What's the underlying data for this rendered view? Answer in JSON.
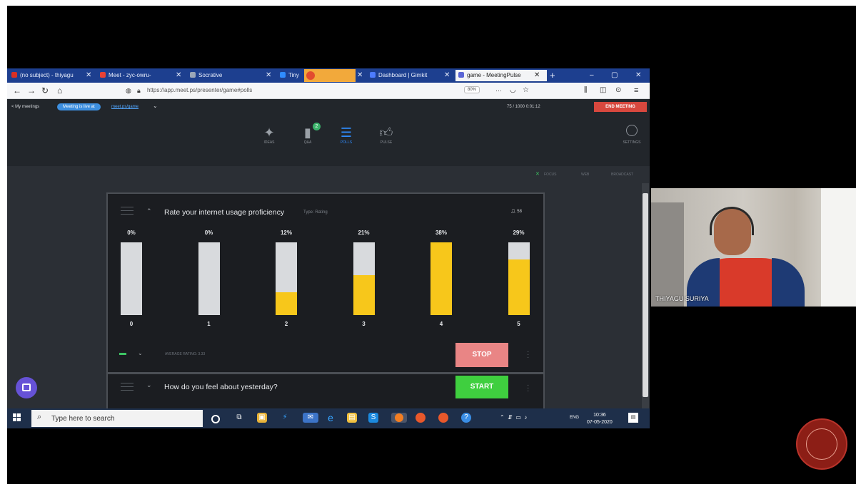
{
  "browser": {
    "tabs": [
      {
        "label": "(no subject) - thiyagu",
        "icon_color": "#d93025"
      },
      {
        "label": "Meet - zyc-owru-",
        "icon_color": "#e94235"
      },
      {
        "label": "Socrative",
        "icon_color": "#9aa6b8"
      },
      {
        "label": "Tiny",
        "icon_color": "#2f8cff"
      },
      {
        "label": "Dashboard | Gimkit",
        "icon_color": "#4d7cff"
      },
      {
        "label": "game - MeetingPulse",
        "icon_color": "#5b66d6"
      }
    ],
    "new_tab": "+",
    "url": "https://app.meet.ps/presenter/game#polls",
    "zoom": "80%"
  },
  "app": {
    "back_label": "< My meetings",
    "live_pill": "Meeting is live at",
    "live_link": "meet.ps/game",
    "stats": "75 / 1000   0:01:12",
    "end_meeting": "END MEETING",
    "nav": [
      {
        "label": "IDEAS",
        "icon": "lightbulb-icon"
      },
      {
        "label": "Q&A",
        "icon": "chat-icon"
      },
      {
        "label": "POLLS",
        "icon": "list-icon"
      },
      {
        "label": "PULSE",
        "icon": "thumbs-up-icon"
      }
    ],
    "qa_badge": "2",
    "settings_label": "SETTINGS",
    "view_options": [
      "FOCUS",
      "WEB",
      "BROADCAST"
    ]
  },
  "poll": {
    "title": "Rate your internet usage proficiency",
    "type_label": "Type: Rating",
    "voters": "58",
    "average_label": "AVERAGE RATING: 3.33",
    "stop_label": "STOP"
  },
  "chart_data": {
    "type": "bar",
    "categories": [
      "0",
      "1",
      "2",
      "3",
      "4",
      "5"
    ],
    "values": [
      0,
      0,
      12,
      21,
      38,
      29
    ],
    "value_labels": [
      "0%",
      "0%",
      "12%",
      "21%",
      "38%",
      "29%"
    ],
    "bar_color": "#f7c71b",
    "track_color": "#d8dadd",
    "scale_max": 38
  },
  "poll2": {
    "title": "How do you feel about yesterday?",
    "start_label": "START"
  },
  "taskbar": {
    "search_placeholder": "Type here to search",
    "lang": "ENG",
    "time": "10:36",
    "date": "07-05-2020"
  },
  "webcam": {
    "name": "THIYAGU SURIYA"
  }
}
